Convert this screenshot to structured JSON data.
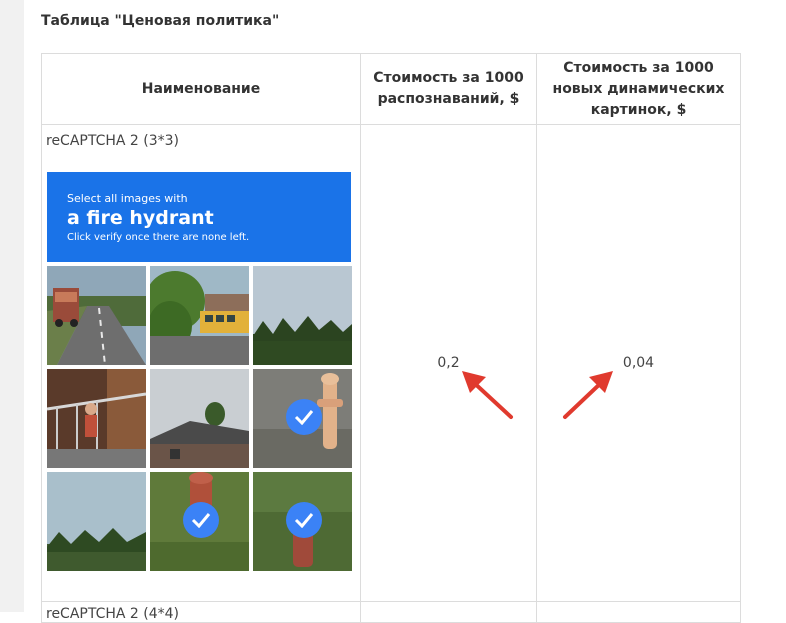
{
  "page": {
    "heading": "Таблица \"Ценовая политика\""
  },
  "table": {
    "headers": [
      "Наименование",
      "Стоимость за 1000 распознаваний, $",
      "Стоимость за 1000 новых динамических картинок, $"
    ],
    "rows": [
      {
        "name": "reCAPTCHA 2 (3*3)",
        "cost_per_1000_recognitions": "0,2",
        "cost_per_1000_dynamic_images": "0,04"
      },
      {
        "name": "reCAPTCHA 2 (4*4)"
      }
    ]
  },
  "captcha_example": {
    "line1": "Select all images with",
    "line2": "a fire hydrant",
    "line3": "Click verify once there are none left.",
    "banner_color": "#1a73e8",
    "tiles": [
      {
        "scene": "road-with-truck",
        "selected": false
      },
      {
        "scene": "school-bus-trees",
        "selected": false
      },
      {
        "scene": "sky-treeline",
        "selected": false
      },
      {
        "scene": "porch-stairs",
        "selected": false
      },
      {
        "scene": "house-roof",
        "selected": false
      },
      {
        "scene": "fire-hydrant",
        "selected": true
      },
      {
        "scene": "field-trees",
        "selected": false
      },
      {
        "scene": "fire-hydrant",
        "selected": true
      },
      {
        "scene": "fire-hydrant",
        "selected": true
      }
    ]
  },
  "annotations": {
    "arrow_color": "#e03a2e"
  }
}
